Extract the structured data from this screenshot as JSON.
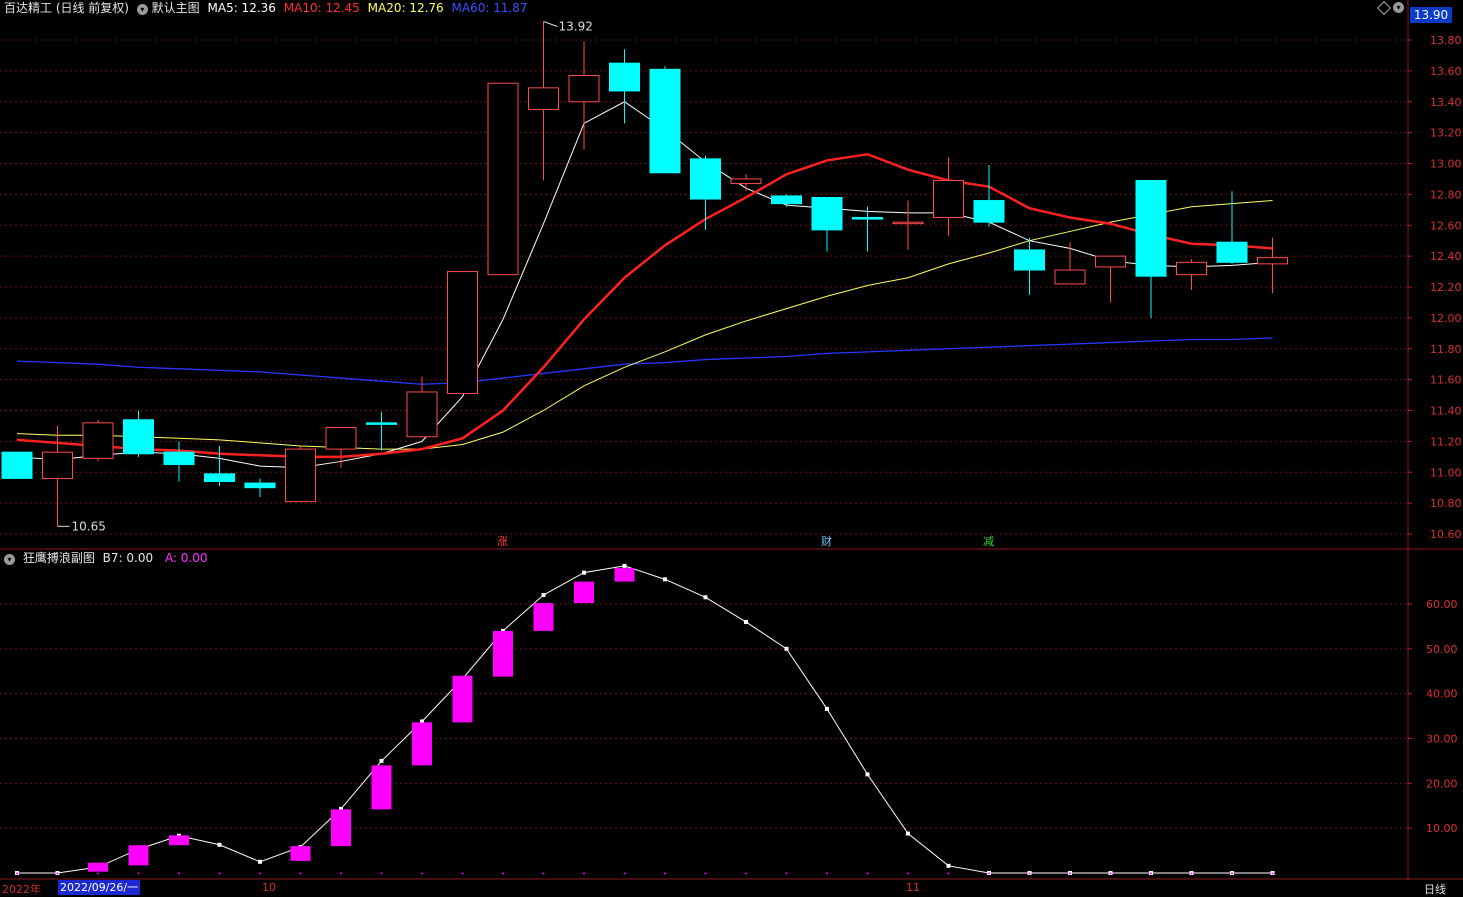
{
  "header": {
    "stock_name": "百达精工 (日线 前复权)",
    "main_chart_name": "默认主图",
    "ma5_label": "MA5: 12.36",
    "ma10_label": "MA10: 12.45",
    "ma20_label": "MA20: 12.76",
    "ma60_label": "MA60: 11.87",
    "current_price_badge": "13.90"
  },
  "sub_header": {
    "indicator_name": "狂鹰搏浪副图",
    "b7_label": "B7: 0.00",
    "a_label": "A: 0.00"
  },
  "bottom_bar": {
    "year_label": "2022年",
    "date_label": "2022/09/26/一",
    "month_oct": "10",
    "month_nov": "11",
    "period_label": "日线"
  },
  "signals": [
    {
      "text": "涨",
      "color": "#ff3a3a"
    },
    {
      "text": "财",
      "color": "#6fc8ff"
    },
    {
      "text": "减",
      "color": "#3ad03a"
    }
  ],
  "colors": {
    "up": "#ff4a4a",
    "down": "#00ffff",
    "ma5": "#ffffff",
    "ma10": "#ff2020",
    "ma20": "#ffff60",
    "ma60": "#2a35ff",
    "grid": "#6a1414",
    "sub_bar": "#ff00ff"
  },
  "chart_data": [
    {
      "type": "candlestick",
      "y_ticks": [
        "13.80",
        "13.60",
        "13.40",
        "13.20",
        "13.00",
        "12.80",
        "12.60",
        "12.40",
        "12.20",
        "12.00",
        "11.80",
        "11.60",
        "11.40",
        "11.20",
        "11.00",
        "10.80",
        "10.60"
      ],
      "ylim": [
        10.55,
        13.95
      ],
      "high_annotation": "13.92",
      "low_annotation": "10.65",
      "candles": [
        {
          "o": 11.13,
          "c": 10.96,
          "h": 11.13,
          "l": 10.96
        },
        {
          "o": 10.96,
          "c": 11.13,
          "h": 11.3,
          "l": 10.65
        },
        {
          "o": 11.09,
          "c": 11.32,
          "h": 11.34,
          "l": 11.07
        },
        {
          "o": 11.34,
          "c": 11.12,
          "h": 11.4,
          "l": 11.1
        },
        {
          "o": 11.13,
          "c": 11.05,
          "h": 11.2,
          "l": 10.94
        },
        {
          "o": 10.99,
          "c": 10.94,
          "h": 11.17,
          "l": 10.91
        },
        {
          "o": 10.93,
          "c": 10.9,
          "h": 10.96,
          "l": 10.84
        },
        {
          "o": 10.81,
          "c": 11.15,
          "h": 11.17,
          "l": 10.81
        },
        {
          "o": 11.15,
          "c": 11.29,
          "h": 11.29,
          "l": 11.03
        },
        {
          "o": 11.32,
          "c": 11.31,
          "h": 11.39,
          "l": 11.14
        },
        {
          "o": 11.23,
          "c": 11.52,
          "h": 11.62,
          "l": 11.23
        },
        {
          "o": 11.51,
          "c": 12.3,
          "h": 12.3,
          "l": 11.51
        },
        {
          "o": 12.28,
          "c": 13.52,
          "h": 13.52,
          "l": 12.28
        },
        {
          "o": 13.35,
          "c": 13.49,
          "h": 13.92,
          "l": 12.89
        },
        {
          "o": 13.4,
          "c": 13.57,
          "h": 13.79,
          "l": 13.09
        },
        {
          "o": 13.65,
          "c": 13.47,
          "h": 13.74,
          "l": 13.26
        },
        {
          "o": 13.61,
          "c": 12.94,
          "h": 13.63,
          "l": 12.94
        },
        {
          "o": 13.03,
          "c": 12.77,
          "h": 13.05,
          "l": 12.57
        },
        {
          "o": 12.87,
          "c": 12.9,
          "h": 12.93,
          "l": 12.82
        },
        {
          "o": 12.79,
          "c": 12.74,
          "h": 12.8,
          "l": 12.72
        },
        {
          "o": 12.78,
          "c": 12.57,
          "h": 12.78,
          "l": 12.43
        },
        {
          "o": 12.65,
          "c": 12.64,
          "h": 12.72,
          "l": 12.43
        },
        {
          "o": 12.62,
          "c": 12.62,
          "h": 12.76,
          "l": 12.44
        },
        {
          "o": 12.65,
          "c": 12.89,
          "h": 13.04,
          "l": 12.53
        },
        {
          "o": 12.76,
          "c": 12.62,
          "h": 12.99,
          "l": 12.59
        },
        {
          "o": 12.44,
          "c": 12.31,
          "h": 12.52,
          "l": 12.15
        },
        {
          "o": 12.22,
          "c": 12.31,
          "h": 12.49,
          "l": 12.22
        },
        {
          "o": 12.33,
          "c": 12.4,
          "h": 12.4,
          "l": 12.1
        },
        {
          "o": 12.89,
          "c": 12.27,
          "h": 12.89,
          "l": 12.0
        },
        {
          "o": 12.28,
          "c": 12.36,
          "h": 12.38,
          "l": 12.18
        },
        {
          "o": 12.49,
          "c": 12.36,
          "h": 12.82,
          "l": 12.35
        },
        {
          "o": 12.35,
          "c": 12.39,
          "h": 12.52,
          "l": 12.16
        }
      ],
      "series": [
        {
          "name": "MA5",
          "values": [
            11.1,
            11.08,
            11.11,
            11.13,
            11.12,
            11.09,
            11.04,
            11.03,
            11.07,
            11.12,
            11.2,
            11.49,
            11.99,
            12.61,
            13.26,
            13.4,
            13.22,
            13.01,
            12.84,
            12.73,
            12.71,
            12.69,
            12.68,
            12.68,
            12.62,
            12.5,
            12.45,
            12.37,
            12.34,
            12.33,
            12.34,
            12.36
          ]
        },
        {
          "name": "MA10",
          "values": [
            11.21,
            11.19,
            11.17,
            11.15,
            11.14,
            11.12,
            11.11,
            11.1,
            11.1,
            11.12,
            11.15,
            11.22,
            11.4,
            11.68,
            11.99,
            12.26,
            12.47,
            12.64,
            12.78,
            12.93,
            13.02,
            13.06,
            12.96,
            12.89,
            12.85,
            12.71,
            12.65,
            12.61,
            12.54,
            12.48,
            12.47,
            12.45
          ]
        },
        {
          "name": "MA20",
          "values": [
            11.25,
            11.24,
            11.24,
            11.23,
            11.22,
            11.21,
            11.19,
            11.17,
            11.16,
            11.15,
            11.15,
            11.18,
            11.26,
            11.4,
            11.56,
            11.68,
            11.78,
            11.89,
            11.98,
            12.06,
            12.14,
            12.21,
            12.26,
            12.35,
            12.42,
            12.5,
            12.56,
            12.62,
            12.67,
            12.72,
            12.74,
            12.76
          ]
        },
        {
          "name": "MA60",
          "values": [
            11.72,
            11.71,
            11.7,
            11.68,
            11.67,
            11.66,
            11.65,
            11.63,
            11.61,
            11.59,
            11.57,
            11.58,
            11.61,
            11.64,
            11.67,
            11.7,
            11.71,
            11.73,
            11.74,
            11.75,
            11.77,
            11.78,
            11.79,
            11.8,
            11.81,
            11.82,
            11.83,
            11.84,
            11.85,
            11.86,
            11.86,
            11.87
          ]
        }
      ]
    },
    {
      "type": "bar",
      "name": "狂鹰搏浪副图",
      "y_ticks": [
        "60.00",
        "50.00",
        "40.00",
        "30.00",
        "20.00",
        "10.00"
      ],
      "ylim": [
        0,
        70
      ],
      "line_values": [
        0,
        0,
        1.3,
        5.3,
        8.3,
        6.3,
        2.5,
        5.8,
        14.3,
        25.0,
        33.8,
        43.3,
        54.0,
        62.0,
        67.0,
        68.5,
        65.5,
        61.5,
        56.0,
        50.0,
        36.6,
        22.0,
        8.8,
        1.6,
        0,
        0,
        0,
        0,
        0,
        0,
        0,
        0
      ],
      "bars": [
        {
          "low": 0,
          "high": 0
        },
        {
          "low": 0,
          "high": 0
        },
        {
          "low": 0.3,
          "high": 2.3
        },
        {
          "low": 1.7,
          "high": 6.2
        },
        {
          "low": 6.2,
          "high": 8.4
        },
        {
          "low": 0,
          "high": 0
        },
        {
          "low": 0,
          "high": 0
        },
        {
          "low": 2.7,
          "high": 6.0
        },
        {
          "low": 6.0,
          "high": 14.2
        },
        {
          "low": 14.2,
          "high": 24.0
        },
        {
          "low": 24.0,
          "high": 33.6
        },
        {
          "low": 33.6,
          "high": 44.0
        },
        {
          "low": 43.8,
          "high": 54.0
        },
        {
          "low": 54.0,
          "high": 60.2
        },
        {
          "low": 60.2,
          "high": 65.0
        },
        {
          "low": 65.0,
          "high": 68.0
        },
        {
          "low": 0,
          "high": 0
        },
        {
          "low": 0,
          "high": 0
        },
        {
          "low": 0,
          "high": 0
        },
        {
          "low": 0,
          "high": 0
        },
        {
          "low": 0,
          "high": 0
        },
        {
          "low": 0,
          "high": 0
        },
        {
          "low": 0,
          "high": 0
        },
        {
          "low": 0,
          "high": 0
        },
        {
          "low": 0,
          "high": 0
        },
        {
          "low": 0,
          "high": 0
        },
        {
          "low": 0,
          "high": 0
        },
        {
          "low": 0,
          "high": 0
        },
        {
          "low": 0,
          "high": 0
        },
        {
          "low": 0,
          "high": 0
        },
        {
          "low": 0,
          "high": 0
        },
        {
          "low": 0,
          "high": 0
        }
      ]
    }
  ]
}
